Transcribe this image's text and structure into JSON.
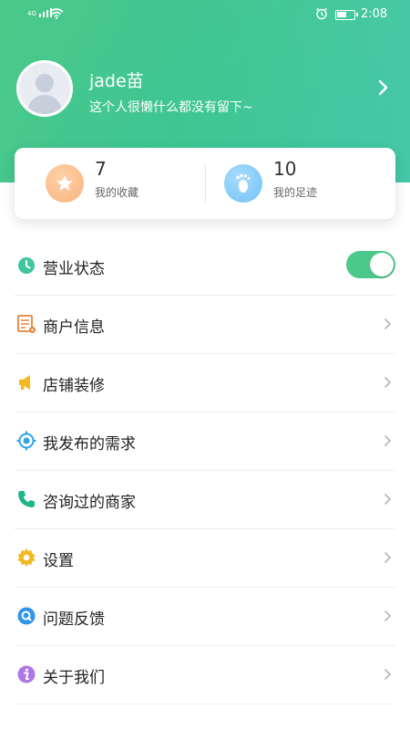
{
  "status_bar": {
    "network": "4G",
    "time": "2:08",
    "battery_level": 0.6
  },
  "profile": {
    "username": "jade苗",
    "signature": "这个人很懒什么都没有留下~"
  },
  "stats": {
    "favorites": {
      "value": "7",
      "label": "我的收藏"
    },
    "footprints": {
      "value": "10",
      "label": "我的足迹"
    }
  },
  "menu": {
    "items": [
      {
        "label": "营业状态",
        "icon": "clock-icon"
      },
      {
        "label": "商户信息",
        "icon": "merchant-info-icon"
      },
      {
        "label": "店铺装修",
        "icon": "megaphone-icon"
      },
      {
        "label": "我发布的需求",
        "icon": "target-icon"
      },
      {
        "label": "咨询过的商家",
        "icon": "phone-icon"
      },
      {
        "label": "设置",
        "icon": "gear-icon"
      },
      {
        "label": "问题反馈",
        "icon": "feedback-icon"
      },
      {
        "label": "关于我们",
        "icon": "info-icon"
      }
    ],
    "business_status_on": true
  },
  "colors": {
    "accent": "#4cc98a",
    "header_gradient_end": "#34c3a0"
  }
}
